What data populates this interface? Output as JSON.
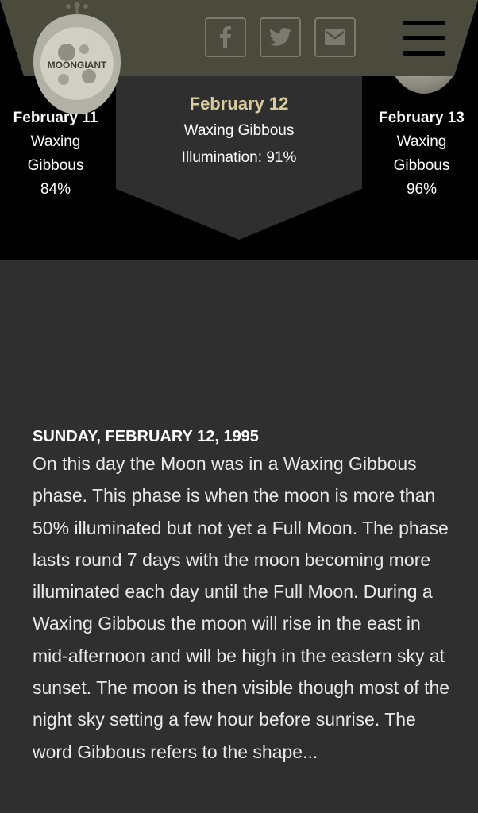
{
  "header": {
    "logo_text": "MOONGIANT",
    "social": {
      "facebook": "facebook-icon",
      "twitter": "twitter-icon",
      "mail": "mail-icon"
    },
    "menu_icon": "hamburger-menu-icon"
  },
  "days": {
    "prev": {
      "date": "February 11",
      "phase_line1": "Waxing",
      "phase_line2": "Gibbous",
      "illumination": "84%"
    },
    "current": {
      "date": "February 12",
      "phase": "Waxing Gibbous",
      "illumination_label": "Illumination:",
      "illumination": "91%"
    },
    "next": {
      "date": "February 13",
      "phase_line1": "Waxing",
      "phase_line2": "Gibbous",
      "illumination": "96%"
    }
  },
  "article": {
    "heading": "SUNDAY, FEBRUARY 12, 1995",
    "body": "On this day the Moon was in a Waxing Gibbous phase. This phase is when the moon is more than 50% illuminated but not yet a Full Moon. The phase lasts round 7 days with the moon becoming more illuminated each day until the Full Moon. During a Waxing Gibbous the moon will rise in the east in mid-afternoon and will be high in the eastern sky at sunset. The moon is then visible though most of the night sky setting a few hour before sunrise. The word Gibbous refers to the shape..."
  },
  "colors": {
    "header": "#4a4a3d",
    "accent_date": "#d8cc9c",
    "panel": "#2f2f2f",
    "background_top": "#000000"
  }
}
